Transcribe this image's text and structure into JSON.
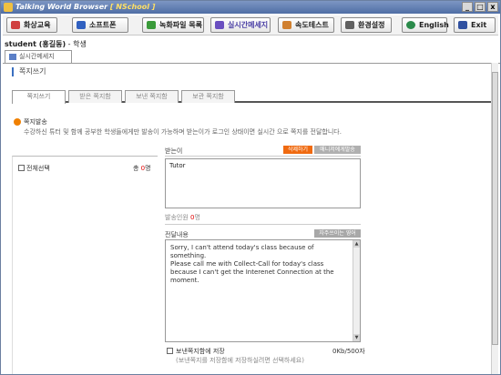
{
  "window": {
    "title": "Talking World Browser",
    "brand": "[ NSchool ]",
    "controls": [
      "_",
      "□",
      "x"
    ]
  },
  "toolbar": {
    "buttons": [
      {
        "label": "화상교육",
        "icon": "video-icon",
        "color": "#d04040"
      },
      {
        "label": "소프트폰",
        "icon": "phone-icon",
        "color": "#3060c0"
      },
      {
        "label": "녹화파일 목록",
        "icon": "record-list-icon",
        "color": "#3a9a3a"
      },
      {
        "label": "실시간메세지",
        "icon": "message-icon",
        "color": "#6a4fc0",
        "active": true
      },
      {
        "label": "속도테스트",
        "icon": "speed-icon",
        "color": "#d08030"
      },
      {
        "label": "환경설정",
        "icon": "settings-icon",
        "color": "#606060"
      },
      {
        "label": "English",
        "icon": "globe-icon",
        "color": "#2a8a4a"
      },
      {
        "label": "Exit",
        "icon": "exit-icon",
        "color": "#3050a0"
      }
    ]
  },
  "user": {
    "name": "student (홍길동)",
    "role": " - 학생"
  },
  "main_tab": {
    "label": "실시간메세지"
  },
  "page": {
    "title": "쪽지쓰기"
  },
  "tabs": [
    {
      "label": "쪽지쓰기",
      "active": true
    },
    {
      "label": "받은 쪽지함",
      "active": false
    },
    {
      "label": "보낸 쪽지함",
      "active": false
    },
    {
      "label": "보관 쪽지함",
      "active": false
    }
  ],
  "notice": {
    "title": "쪽지발송",
    "text": "수강하신 튜터 및 함께 공부한 학생들에게만 발송이 가능하며 받는이가 로그인 상태이면 실시간 으로 쪽지를 전달합니다."
  },
  "left_panel": {
    "select_all": "전체선택",
    "total_prefix": "총 ",
    "total_count": "0",
    "total_suffix": "명"
  },
  "recipients": {
    "label": "받는이",
    "delete_button": "삭제하기",
    "manager_button": "매니저에게발송",
    "value": "Tutor",
    "count_label": "발송인원 ",
    "count_value": "0",
    "count_suffix": "명"
  },
  "message": {
    "label": "전달내용",
    "phrases_button": "자주쓰이는 영어",
    "body": "Sorry, I can't attend today's class because of something.\nPlease call me with Collect-Call for today's class because I can't get the Interenet Connection at the moment."
  },
  "save": {
    "label": "보낸쪽지함에 저장",
    "hint": "(보낸쪽지를 저장함에 저장하실려면 선택하세요)",
    "byte_count": "0Kb/500자"
  }
}
